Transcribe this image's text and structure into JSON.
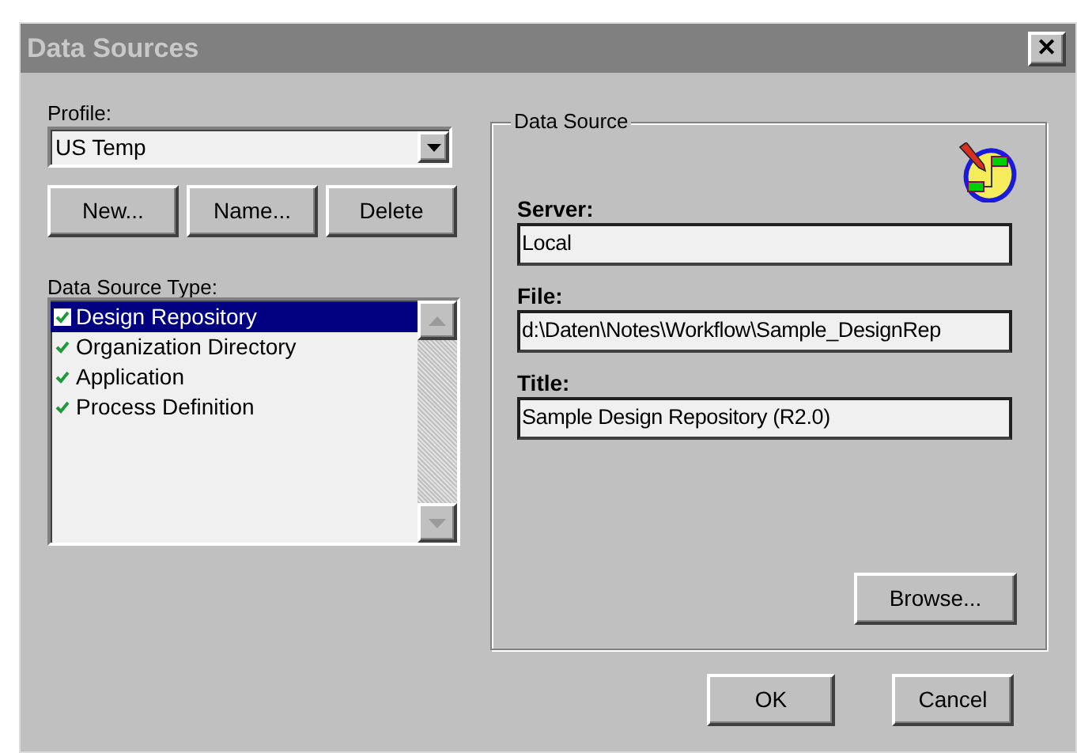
{
  "window": {
    "title": "Data Sources",
    "close": "✕"
  },
  "profile": {
    "label": "Profile:",
    "value": "US Temp"
  },
  "profile_buttons": [
    "New...",
    "Name...",
    "Delete"
  ],
  "type_list": {
    "label": "Data Source Type:",
    "items": [
      {
        "label": "Design Repository",
        "checked": true,
        "selected": true
      },
      {
        "label": "Organization Directory",
        "checked": true,
        "selected": false
      },
      {
        "label": "Application",
        "checked": true,
        "selected": false
      },
      {
        "label": "Process Definition",
        "checked": true,
        "selected": false
      }
    ]
  },
  "data_source": {
    "title": "Data Source",
    "fields": [
      {
        "label": "Server:",
        "value": "Local"
      },
      {
        "label": "File:",
        "value": "d:\\Daten\\Notes\\Workflow\\Sample_DesignRep"
      },
      {
        "label": "Title:",
        "value": "Sample Design Repository (R2.0)"
      }
    ],
    "browse": "Browse..."
  },
  "buttons": [
    "OK",
    "Cancel"
  ]
}
